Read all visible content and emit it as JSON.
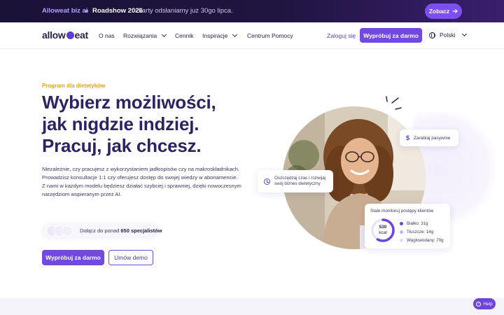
{
  "announcement": {
    "brand": "Alloweat biz ai",
    "event": "Roadshow 2026",
    "separator": "-",
    "event_desc": "karty odsłaniamy już 30go lipca.",
    "cta_label": "Zobacz",
    "cta_icon": "arrow-right-icon"
  },
  "nav": {
    "logo_left": "allow",
    "logo_right": "eat",
    "items": [
      {
        "label": "O nas",
        "has_dropdown": false
      },
      {
        "label": "Rozwiązania",
        "has_dropdown": true
      },
      {
        "label": "Cennik",
        "has_dropdown": false
      },
      {
        "label": "Inspiracje",
        "has_dropdown": true
      },
      {
        "label": "Centrum Pomocy",
        "has_dropdown": false
      }
    ],
    "login_label": "Zaloguj się",
    "cta_label": "Wypróbuj za darmo",
    "language": "Polski",
    "language_icon": "globe-icon"
  },
  "hero": {
    "eyebrow": "Program dla dietetyków",
    "headline": [
      "Wybierz możliwości,",
      "jak nigdzie indziej.",
      "Pracuj, jak chcesz."
    ],
    "description": [
      "Niezależnie, czy pracujesz z wykorzystaniem jadłospisów czy na makroskładnikach.",
      "Prowadzisz konsultacje 1:1 czy oferujesz dostęp do swojej wiedzy w abonamencie.",
      "Z nami w każdym modelu będziesz działać szybciej i sprawniej, dzięki nowoczesnym",
      "narzędziom wspieranym przez AI."
    ],
    "join_prefix": "Dołącz do ponad",
    "join_count": "650 specjalistów",
    "primary_cta": "Wypróbuj za darmo",
    "secondary_cta": "Umów demo"
  },
  "illustration": {
    "earn_card": {
      "icon": "dollar-icon",
      "label": "Zarabiaj pasywnie"
    },
    "save_card": {
      "icon": "clock-icon",
      "lines": [
        "Oszczędzaj czas i rozwijaj",
        "swój biznes dietetyczny"
      ]
    },
    "macro_card": {
      "title": "Stale monitoruj postępy klientów",
      "calories_value": "530",
      "calories_unit": "kcal",
      "legend": [
        {
          "label": "Białko: 31g",
          "color": "#6d45de"
        },
        {
          "label": "Tłuszcze: 14g",
          "color": "#c7b3f5"
        },
        {
          "label": "Węglowodany: 70g",
          "color": "#e4def0"
        }
      ]
    }
  },
  "help": {
    "label": "Help",
    "icon": "question-icon"
  }
}
